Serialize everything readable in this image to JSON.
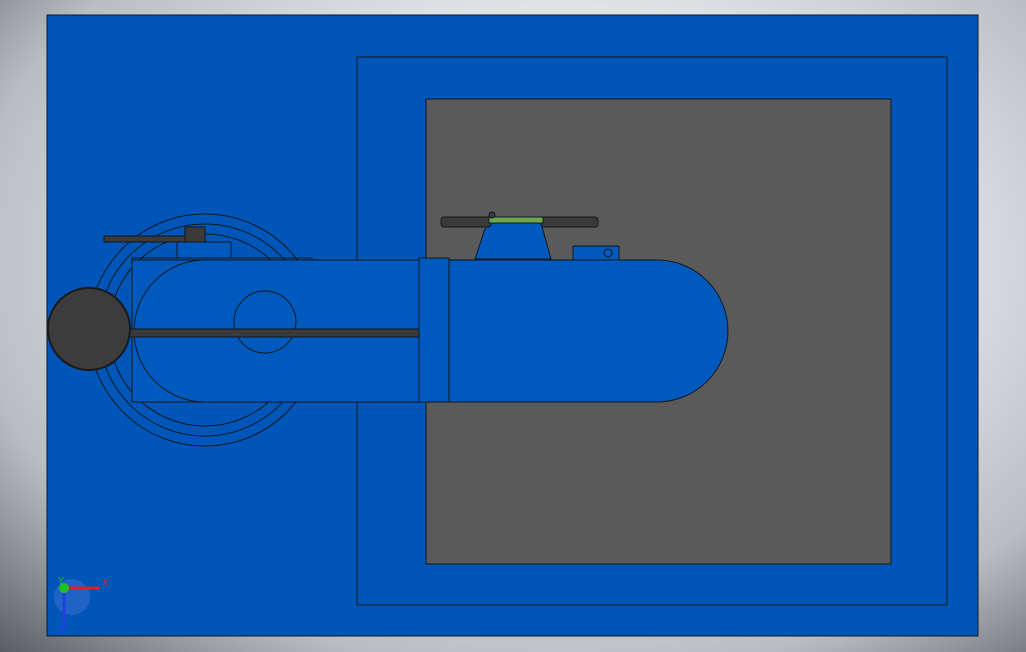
{
  "app": {
    "view": "top-view",
    "background": "gradient-grey"
  },
  "colors": {
    "base_plate": "#0056b8",
    "inner_plate": "#5a5a5a",
    "arm_blue": "#0059bd",
    "hub_dark": "#3c3c3c",
    "rod_dark": "#3a3a3a",
    "outline": "#101820",
    "green_accent": "#6fa84a",
    "axis_x": "#e02020",
    "axis_y": "#20c020",
    "axis_z": "#2040e0"
  },
  "triad": {
    "x_label": "X",
    "y_label": "Y",
    "z_label": "Z"
  },
  "icons": {
    "triad": "coordinate-triad-icon"
  }
}
